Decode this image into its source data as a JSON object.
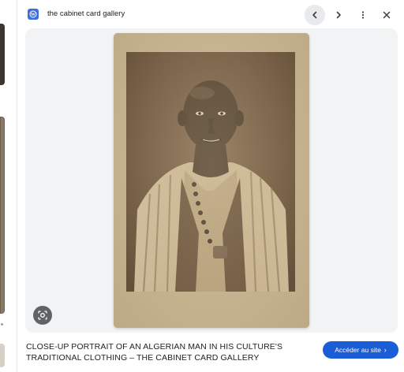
{
  "header": {
    "site_name": "the cabinet card gallery",
    "site_icon": "wordpress-icon"
  },
  "nav": {
    "prev_icon": "chevron-left-icon",
    "next_icon": "chevron-right-icon",
    "more_icon": "more-vert-icon",
    "close_icon": "close-icon"
  },
  "image": {
    "lens_icon": "google-lens-icon"
  },
  "caption": {
    "title": "CLOSE-UP PORTRAIT OF AN ALGERIAN MAN IN HIS CULTURE'S TRADITIONAL CLOTHING – THE CABINET CARD GALLERY"
  },
  "visit": {
    "label": "Accéder au site",
    "chevron": "›"
  },
  "colors": {
    "accent_button": "#1a5dd6",
    "site_icon_bg": "#3b6fe0",
    "image_area_bg": "#f1f3f4",
    "card_mount": "#c9b896"
  }
}
